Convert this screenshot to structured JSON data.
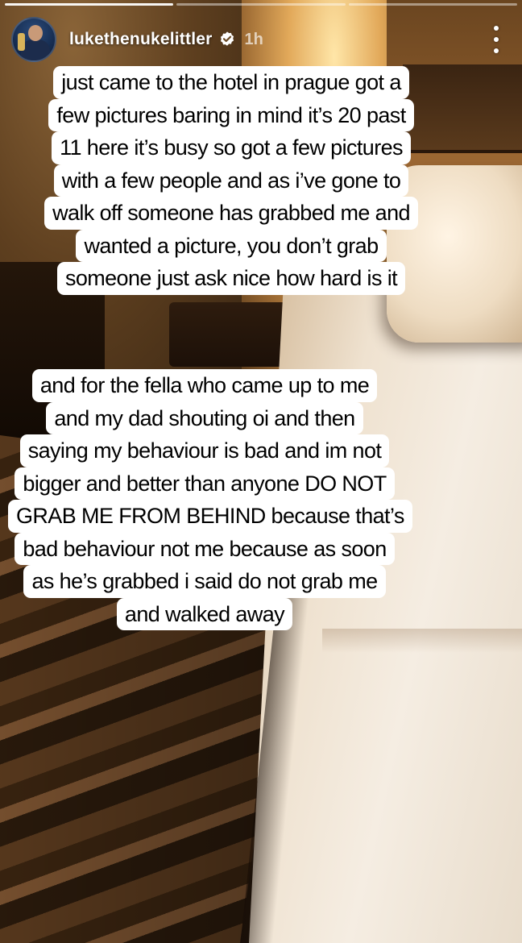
{
  "story": {
    "segments_total": 3,
    "segments_done": 1,
    "user": {
      "username": "lukethenukelittler",
      "verified": true,
      "posted_ago": "1h"
    }
  },
  "captions": [
    {
      "lines": [
        "just came to the hotel in prague got a",
        "few pictures baring in mind it’s 20 past",
        "11 here it’s busy so got a few pictures",
        "with a few people and as i’ve gone to",
        "walk off someone has grabbed me and",
        "wanted a picture, you don’t grab",
        "someone just ask nice how hard is it"
      ]
    },
    {
      "lines": [
        "and for the fella who came up to me",
        "and my dad shouting oi and then",
        "saying my behaviour is bad and im not",
        "bigger and better than anyone DO NOT",
        "GRAB ME FROM BEHIND because that’s",
        "bad behaviour not me because as soon",
        "as he’s grabbed i said do not grab me",
        "and walked away"
      ]
    }
  ],
  "icons": {
    "verified": "verified-badge-icon",
    "more": "more-options-icon"
  },
  "colors": {
    "caption_background": "#ffffff",
    "caption_text": "#000000",
    "verified_badge": "#ffffff"
  }
}
